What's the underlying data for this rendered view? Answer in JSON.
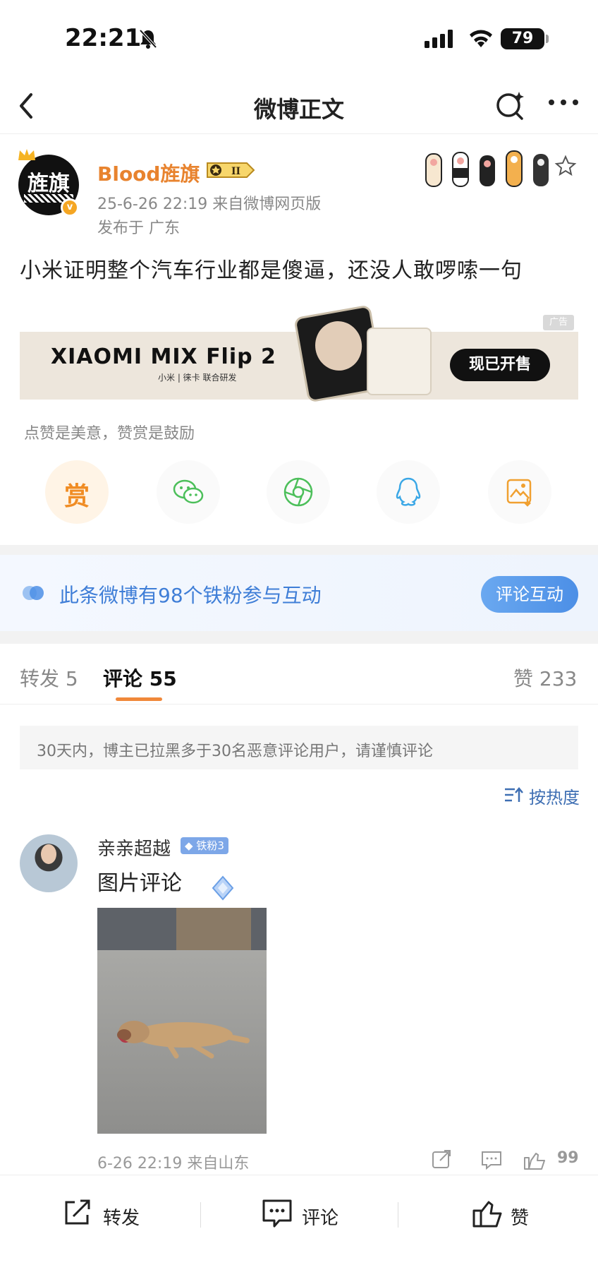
{
  "status_bar": {
    "time": "22:21",
    "battery": "79"
  },
  "nav": {
    "title": "微博正文"
  },
  "post": {
    "avatar_text": "旌旗",
    "username": "Blood旌旗",
    "meta": "25-6-26 22:19  来自微博网页版",
    "location": "发布于 广东",
    "text": "小米证明整个汽车行业都是傻逼，还没人敢啰嗦一句"
  },
  "ad": {
    "label": "广告",
    "brand": "XIAOMI MIX Flip 2",
    "sub": "小米 | 徕卡  联合研发",
    "cta": "现已开售"
  },
  "reward_hint": "点赞是美意，赞赏是鼓励",
  "share": {
    "reward_char": "赏"
  },
  "iron_fans": {
    "text": "此条微博有98个铁粉参与互动",
    "button": "评论互动"
  },
  "tabs": {
    "repost": "转发 5",
    "comment": "评论 55",
    "like": "赞 233"
  },
  "notice": "30天内，博主已拉黑多于30名恶意评论用户，请谨慎评论",
  "sort_label": "按热度",
  "comment": {
    "name": "亲亲超越",
    "badge": "铁粉3",
    "text": "图片评论",
    "meta": "6-26 22:19  来自山东",
    "like_count": "99"
  },
  "bottom_bar": {
    "repost": "转发",
    "comment": "评论",
    "like": "赞"
  },
  "colors": {
    "accent_orange": "#e8832e",
    "link_blue": "#3f7ed7",
    "tab_underline": "#f0883a"
  }
}
